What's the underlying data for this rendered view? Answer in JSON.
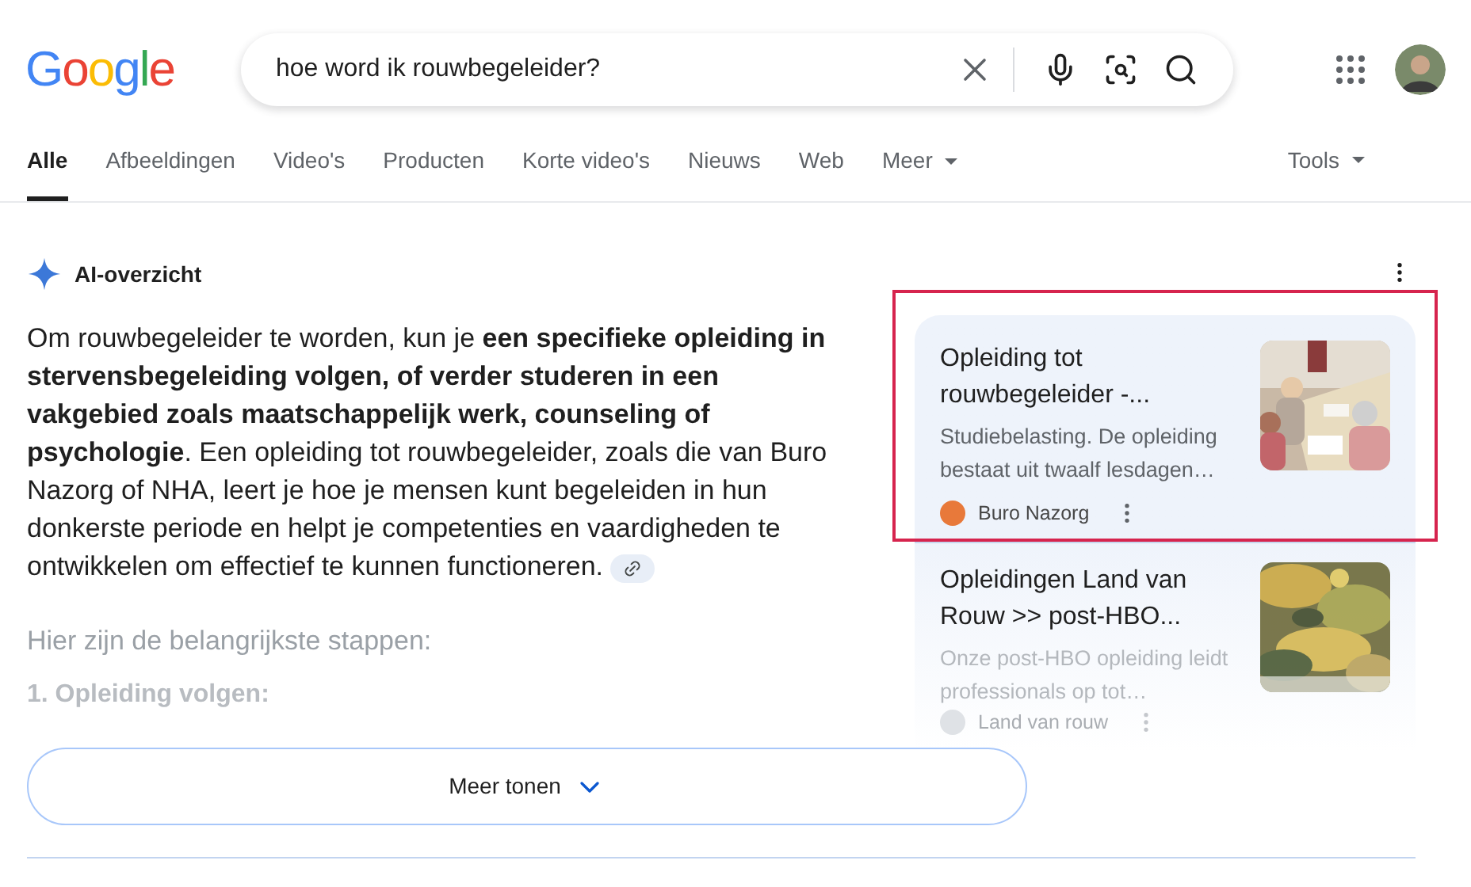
{
  "logo": "Google",
  "search": {
    "value": "hoe word ik rouwbegeleider?"
  },
  "tabs": [
    {
      "label": "Alle",
      "selected": true,
      "dropdown": false
    },
    {
      "label": "Afbeeldingen",
      "selected": false,
      "dropdown": false
    },
    {
      "label": "Video's",
      "selected": false,
      "dropdown": false
    },
    {
      "label": "Producten",
      "selected": false,
      "dropdown": false
    },
    {
      "label": "Korte video's",
      "selected": false,
      "dropdown": false
    },
    {
      "label": "Nieuws",
      "selected": false,
      "dropdown": false
    },
    {
      "label": "Web",
      "selected": false,
      "dropdown": false
    },
    {
      "label": "Meer",
      "selected": false,
      "dropdown": true
    }
  ],
  "tools": "Tools",
  "ai_overview": {
    "title": "AI-overzicht",
    "paragraph": "Om rouwbegeleider te worden, kun je **een specifieke opleiding in stervensbegeleiding volgen, of verder studeren in een vakgebied zoals maatschappelijk werk, counseling of psychologie**. Een opleiding tot rouwbegeleider, zoals die van Buro Nazorg of NHA, leert je hoe je mensen kunt begeleiden in hun donkerste periode en helpt je competenties en vaardigheden te ontwikkelen om effectief te kunnen functioneren.",
    "subheading": "Hier zijn de belangrijkste stappen:",
    "step": "1. Opleiding volgen:",
    "more_button": "Meer tonen"
  },
  "sources": [
    {
      "title": "Opleiding tot rouwbegeleider -...",
      "snippet": "Studiebelasting. De opleiding bestaat uit twaalf lesdagen…",
      "source": "Buro Nazorg",
      "faded": false,
      "highlighted": true
    },
    {
      "title": "Opleidingen Land van Rouw >> post-HBO...",
      "snippet": "Onze post-HBO opleiding leidt professionals op tot…",
      "source": "Land van rouw",
      "faded": true,
      "highlighted": false
    }
  ]
}
